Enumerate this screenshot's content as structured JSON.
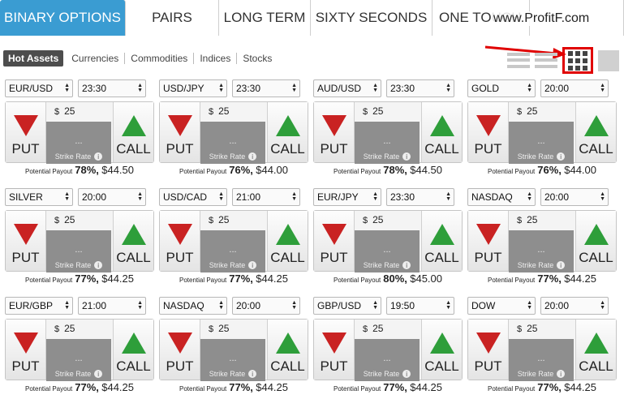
{
  "tabs": [
    "BINARY OPTIONS",
    "PAIRS",
    "LONG TERM",
    "SIXTY SECONDS",
    "ONE TOUCH",
    ""
  ],
  "watermark": "www.ProfitF.com",
  "filters": [
    "Hot Assets",
    "Currencies",
    "Commodities",
    "Indices",
    "Stocks"
  ],
  "common": {
    "currency_symbol": "$",
    "amount": "25",
    "strike_dots": "...",
    "strike_label": "Strike Rate",
    "info_glyph": "i",
    "put_label": "PUT",
    "call_label": "CALL",
    "payout_label": "Potential Payout"
  },
  "cards": [
    {
      "asset": "EUR/USD",
      "time": "23:30",
      "pct": "78%,",
      "payout": "$44.50"
    },
    {
      "asset": "USD/JPY",
      "time": "23:30",
      "pct": "76%,",
      "payout": "$44.00"
    },
    {
      "asset": "AUD/USD",
      "time": "23:30",
      "pct": "78%,",
      "payout": "$44.50"
    },
    {
      "asset": "GOLD",
      "time": "20:00",
      "pct": "76%,",
      "payout": "$44.00"
    },
    {
      "asset": "SILVER",
      "time": "20:00",
      "pct": "77%,",
      "payout": "$44.25"
    },
    {
      "asset": "USD/CAD",
      "time": "21:00",
      "pct": "77%,",
      "payout": "$44.25"
    },
    {
      "asset": "EUR/JPY",
      "time": "23:30",
      "pct": "80%,",
      "payout": "$45.00"
    },
    {
      "asset": "NASDAQ",
      "time": "20:00",
      "pct": "77%,",
      "payout": "$44.25"
    },
    {
      "asset": "EUR/GBP",
      "time": "21:00",
      "pct": "77%,",
      "payout": "$44.25"
    },
    {
      "asset": "NASDAQ",
      "time": "20:00",
      "pct": "77%,",
      "payout": "$44.25"
    },
    {
      "asset": "GBP/USD",
      "time": "19:50",
      "pct": "77%,",
      "payout": "$44.25"
    },
    {
      "asset": "DOW",
      "time": "20:00",
      "pct": "77%,",
      "payout": "$44.25"
    }
  ],
  "colors": {
    "accent": "#3a9cd2",
    "put": "#c92222",
    "call": "#2e9e3a",
    "highlight_box": "#e00000"
  }
}
